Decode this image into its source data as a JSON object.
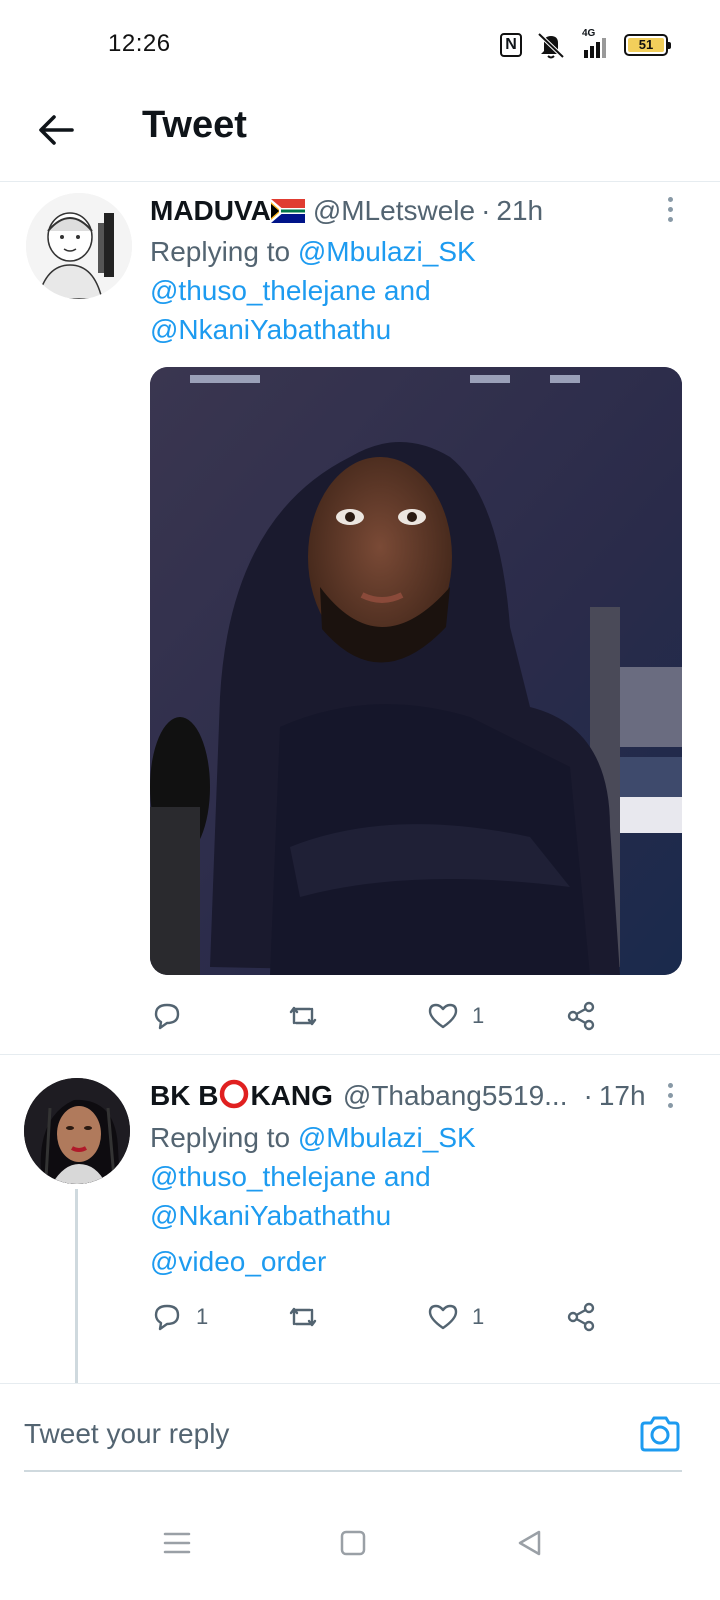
{
  "status_bar": {
    "time": "12:26",
    "network": "4G",
    "battery_level": "51",
    "icons": [
      "nfc-icon",
      "mute-icon",
      "signal-icon",
      "battery-icon"
    ]
  },
  "header": {
    "title": "Tweet",
    "back_icon": "arrow-left-icon"
  },
  "tweets": [
    {
      "display_name": "MADUVA",
      "name_suffix_icon": "south-africa-flag-icon",
      "handle": "@MLetswele",
      "separator": "·",
      "time": "21h",
      "replying_prefix": "Replying to ",
      "mention_1": "@Mbulazi_SK",
      "mention_2": "@thuso_thelejane",
      "and_word": " and",
      "mention_3": "@NkaniYabathathu",
      "has_image": true,
      "actions": {
        "reply_count": "",
        "retweet_count": "",
        "like_count": "1"
      }
    },
    {
      "display_name_part1": "BK B",
      "display_name_part2": "KANG",
      "handle": "@Thabang5519...",
      "separator": "·",
      "time": "17h",
      "replying_prefix": "Replying to ",
      "mention_1": "@Mbulazi_SK",
      "mention_2": "@thuso_thelejane",
      "and_word": " and",
      "mention_3": "@NkaniYabathathu",
      "body_mention": "@video_order",
      "actions": {
        "reply_count": "1",
        "retweet_count": "",
        "like_count": "1"
      }
    }
  ],
  "composer": {
    "placeholder": "Tweet your reply",
    "camera_icon": "camera-icon"
  },
  "nav_bar": {
    "icons": [
      "menu-icon",
      "home-square-icon",
      "back-triangle-icon"
    ]
  },
  "colors": {
    "accent": "#1d9bf0",
    "text": "#0f1419",
    "secondary": "#536471",
    "divider": "#e6ecf0"
  }
}
